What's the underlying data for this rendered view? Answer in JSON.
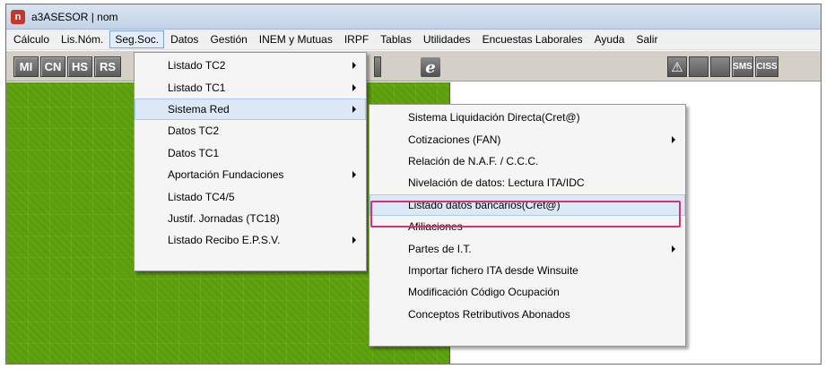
{
  "window": {
    "icon_letter": "n",
    "title": "a3ASESOR | nom"
  },
  "menubar": {
    "items": [
      "Cálculo",
      "Lis.Nóm.",
      "Seg.Soc.",
      "Datos",
      "Gestión",
      "INEM y Mutuas",
      "IRPF",
      "Tablas",
      "Utilidades",
      "Encuestas Laborales",
      "Ayuda",
      "Salir"
    ],
    "active_index": 2
  },
  "toolbar": {
    "buttons": [
      "MI",
      "CN",
      "HS",
      "RS"
    ],
    "right_buttons": [
      "SMS",
      "CISS"
    ],
    "ie_label": "e",
    "bell_glyph": "⚠"
  },
  "segsoc_menu": {
    "items": [
      {
        "label": "Listado TC2",
        "submenu": true
      },
      {
        "label": "Listado TC1",
        "submenu": true
      },
      {
        "label": "Sistema Red",
        "submenu": true
      },
      {
        "label": "Datos TC2",
        "submenu": false
      },
      {
        "label": "Datos TC1",
        "submenu": false
      },
      {
        "label": "Aportación Fundaciones",
        "submenu": true
      },
      {
        "label": "Listado TC4/5",
        "submenu": false
      },
      {
        "label": "Justif. Jornadas (TC18)",
        "submenu": false
      },
      {
        "label": "Listado Recibo E.P.S.V.",
        "submenu": true
      }
    ],
    "hovered_index": 2
  },
  "sistema_red_menu": {
    "items": [
      {
        "label": "Sistema Liquidación Directa(Cret@)",
        "submenu": false
      },
      {
        "label": "Cotizaciones (FAN)",
        "submenu": true
      },
      {
        "label": "Relación de N.A.F. / C.C.C.",
        "submenu": false
      },
      {
        "label": "Nivelación de datos: Lectura ITA/IDC",
        "submenu": false
      },
      {
        "label": "Listado datos bancarios(Cret@)",
        "submenu": false
      },
      {
        "label": "Afiliaciones",
        "submenu": false
      },
      {
        "label": "Partes de I.T.",
        "submenu": true
      },
      {
        "label": "Importar fichero ITA desde Winsuite",
        "submenu": false
      },
      {
        "label": "Modificación Código Ocupación",
        "submenu": false
      },
      {
        "label": "Conceptos Retributivos Abonados",
        "submenu": false
      }
    ],
    "hovered_index": 4
  },
  "colors": {
    "highlight_border": "#d6336c",
    "workspace_green": "#5fa10e"
  }
}
